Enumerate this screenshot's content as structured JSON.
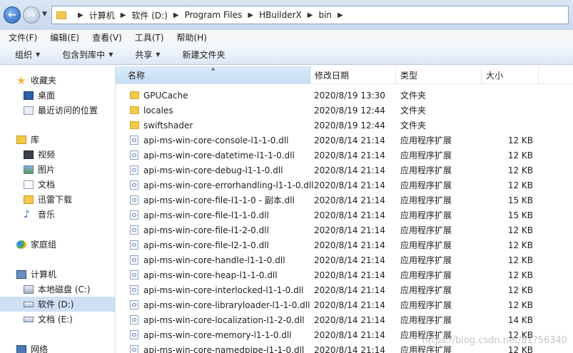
{
  "address_bar": {
    "crumbs": [
      "计算机",
      "软件 (D:)",
      "Program Files",
      "HBuilderX",
      "bin"
    ]
  },
  "menu": [
    "文件(F)",
    "编辑(E)",
    "查看(V)",
    "工具(T)",
    "帮助(H)"
  ],
  "toolbar": {
    "organize": "组织",
    "include_in_library": "包含到库中",
    "share": "共享",
    "new_folder": "新建文件夹"
  },
  "sidebar": {
    "favorites": {
      "title": "收藏夹",
      "items": [
        "桌面",
        "最近访问的位置"
      ]
    },
    "libraries": {
      "title": "库",
      "items": [
        "视频",
        "图片",
        "文档",
        "迅雷下载",
        "音乐"
      ]
    },
    "homegroup": "家庭组",
    "computer": {
      "title": "计算机",
      "items": [
        "本地磁盘 (C:)",
        "软件 (D:)",
        "文档 (E:)"
      ],
      "selected_index": 1
    },
    "network": "网络"
  },
  "columns": {
    "name": "名称",
    "date": "修改日期",
    "type": "类型",
    "size": "大小"
  },
  "files": [
    {
      "name": "GPUCache",
      "date": "2020/8/19 13:30",
      "type": "文件夹",
      "size": "",
      "icon": "folder"
    },
    {
      "name": "locales",
      "date": "2020/8/19 12:44",
      "type": "文件夹",
      "size": "",
      "icon": "folder"
    },
    {
      "name": "swiftshader",
      "date": "2020/8/19 12:44",
      "type": "文件夹",
      "size": "",
      "icon": "folder"
    },
    {
      "name": "api-ms-win-core-console-l1-1-0.dll",
      "date": "2020/8/14 21:14",
      "type": "应用程序扩展",
      "size": "12 KB",
      "icon": "dll"
    },
    {
      "name": "api-ms-win-core-datetime-l1-1-0.dll",
      "date": "2020/8/14 21:14",
      "type": "应用程序扩展",
      "size": "12 KB",
      "icon": "dll"
    },
    {
      "name": "api-ms-win-core-debug-l1-1-0.dll",
      "date": "2020/8/14 21:14",
      "type": "应用程序扩展",
      "size": "12 KB",
      "icon": "dll"
    },
    {
      "name": "api-ms-win-core-errorhandling-l1-1-0.dll",
      "date": "2020/8/14 21:14",
      "type": "应用程序扩展",
      "size": "12 KB",
      "icon": "dll"
    },
    {
      "name": "api-ms-win-core-file-l1-1-0 - 副本.dll",
      "date": "2020/8/14 21:14",
      "type": "应用程序扩展",
      "size": "15 KB",
      "icon": "dll"
    },
    {
      "name": "api-ms-win-core-file-l1-1-0.dll",
      "date": "2020/8/14 21:14",
      "type": "应用程序扩展",
      "size": "15 KB",
      "icon": "dll"
    },
    {
      "name": "api-ms-win-core-file-l1-2-0.dll",
      "date": "2020/8/14 21:14",
      "type": "应用程序扩展",
      "size": "12 KB",
      "icon": "dll"
    },
    {
      "name": "api-ms-win-core-file-l2-1-0.dll",
      "date": "2020/8/14 21:14",
      "type": "应用程序扩展",
      "size": "12 KB",
      "icon": "dll"
    },
    {
      "name": "api-ms-win-core-handle-l1-1-0.dll",
      "date": "2020/8/14 21:14",
      "type": "应用程序扩展",
      "size": "12 KB",
      "icon": "dll"
    },
    {
      "name": "api-ms-win-core-heap-l1-1-0.dll",
      "date": "2020/8/14 21:14",
      "type": "应用程序扩展",
      "size": "12 KB",
      "icon": "dll"
    },
    {
      "name": "api-ms-win-core-interlocked-l1-1-0.dll",
      "date": "2020/8/14 21:14",
      "type": "应用程序扩展",
      "size": "12 KB",
      "icon": "dll"
    },
    {
      "name": "api-ms-win-core-libraryloader-l1-1-0.dll",
      "date": "2020/8/14 21:14",
      "type": "应用程序扩展",
      "size": "12 KB",
      "icon": "dll"
    },
    {
      "name": "api-ms-win-core-localization-l1-2-0.dll",
      "date": "2020/8/14 21:14",
      "type": "应用程序扩展",
      "size": "14 KB",
      "icon": "dll"
    },
    {
      "name": "api-ms-win-core-memory-l1-1-0.dll",
      "date": "2020/8/14 21:14",
      "type": "应用程序扩展",
      "size": "12 KB",
      "icon": "dll"
    },
    {
      "name": "api-ms-win-core-namedpipe-l1-1-0.dll",
      "date": "2020/8/14 21:14",
      "type": "应用程序扩展",
      "size": "12 KB",
      "icon": "dll"
    }
  ],
  "watermark": "https://blog.csdn.net/a1?56340"
}
